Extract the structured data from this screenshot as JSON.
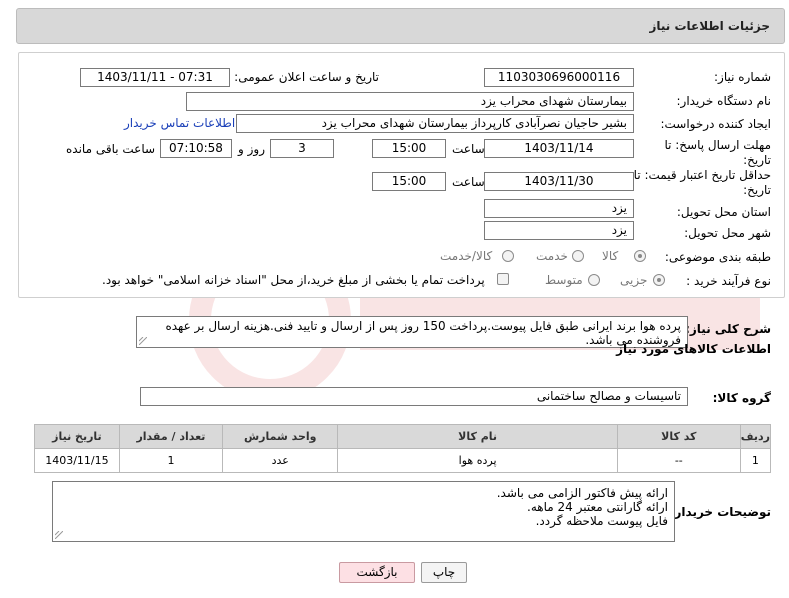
{
  "header": {
    "title": "جزئیات اطلاعات نیاز"
  },
  "form": {
    "need_number_label": "شماره نیاز:",
    "need_number": "1103030696000116",
    "announce_label": "تاریخ و ساعت اعلان عمومی:",
    "announce_value": "1403/11/11 - 07:31",
    "buyer_label": "نام دستگاه خریدار:",
    "buyer_value": "بیمارستان شهدای محراب یزد",
    "creator_label": "ایجاد کننده درخواست:",
    "creator_value": "بشیر حاجیان نصرآبادی کارپرداز بیمارستان شهدای محراب یزد",
    "contact_link": "اطلاعات تماس خریدار",
    "deadline_label": "مهلت ارسال پاسخ: تا تاریخ:",
    "deadline_date": "1403/11/14",
    "time_label": "ساعت",
    "deadline_time": "15:00",
    "days_value": "3",
    "days_label": "روز و",
    "remaining_time": "07:10:58",
    "remaining_label": "ساعت باقی مانده",
    "validity_label": "حداقل تاریخ اعتبار قیمت: تا تاریخ:",
    "validity_date": "1403/11/30",
    "validity_time": "15:00",
    "province_label": "استان محل تحویل:",
    "province_value": "یزد",
    "city_label": "شهر محل تحویل:",
    "city_value": "یزد",
    "category_label": "طبقه بندی موضوعی:",
    "category_options": [
      "کالا",
      "خدمت",
      "کالا/خدمت"
    ],
    "process_label": "نوع فرآیند خرید :",
    "process_options": [
      "جزیی",
      "متوسط"
    ],
    "payment_note": "پرداخت تمام یا بخشی از مبلغ خرید،از محل \"اسناد خزانه اسلامی\" خواهد بود."
  },
  "description": {
    "label": "شرح کلی نیاز:",
    "text": "پرده هوا برند ایرانی طبق فایل پیوست.پرداخت 150 روز پس از ارسال و تایید فنی.هزینه ارسال بر عهده فروشنده می باشد."
  },
  "goods": {
    "section_title": "اطلاعات کالاهای مورد نیاز",
    "group_label": "گروه کالا:",
    "group_value": "تاسیسات و مصالح ساختمانی",
    "columns": [
      "ردیف",
      "کد کالا",
      "نام کالا",
      "واحد شمارش",
      "تعداد / مقدار",
      "تاریخ نیاز"
    ],
    "rows": [
      [
        "1",
        "--",
        "پرده هوا",
        "عدد",
        "1",
        "1403/11/15"
      ]
    ]
  },
  "buyer_notes": {
    "label": "توضیحات خریدار:",
    "lines": [
      "ارائه پیش فاکتور الزامی می باشد.",
      "ارائه گارانتی معتبر 24 ماهه.",
      "فایل پیوست ملاحظه گردد."
    ]
  },
  "buttons": {
    "back": "بازگشت",
    "print": "چاپ"
  }
}
